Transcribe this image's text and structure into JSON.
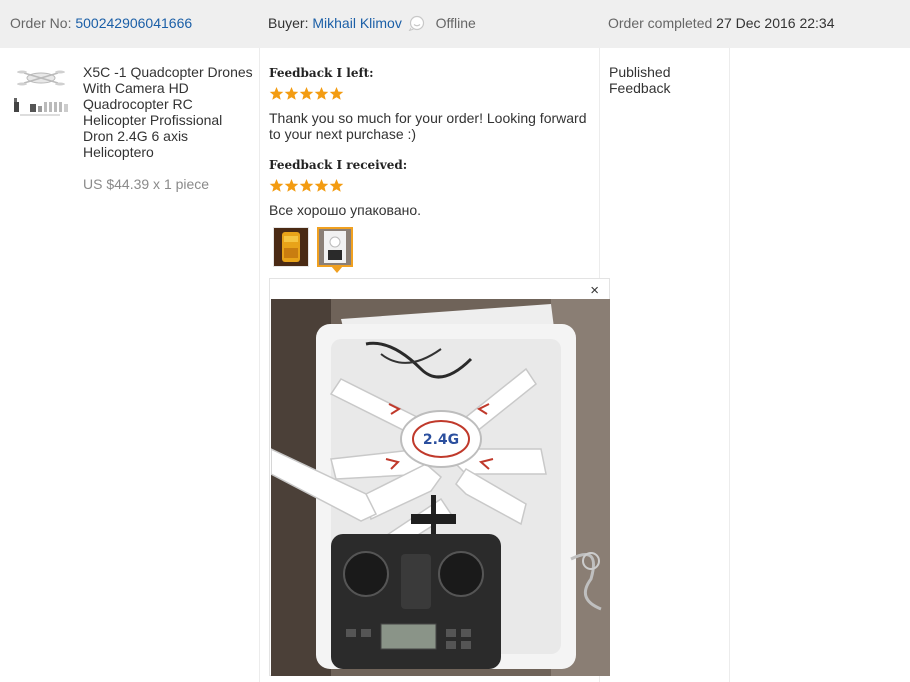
{
  "order": {
    "number_label": "Order No:",
    "number": "500242906041666",
    "buyer_label": "Buyer:",
    "buyer_name": "Mikhail Klimov",
    "buyer_status": "Offline",
    "status_label": "Order completed",
    "completed_date": "27 Dec 2016 22:34"
  },
  "product": {
    "title": "X5C -1 Quadcopter Drones With Camera HD Quadrocopter RC Helicopter Profissional Dron 2.4G 6 axis Helicoptero",
    "price_line": "US $44.39 x 1 piece"
  },
  "feedback_left": {
    "heading": "Feedback I left:",
    "stars": 5,
    "text": "Thank you so much for your order! Looking forward to your next purchase :)"
  },
  "feedback_received": {
    "heading": "Feedback I received:",
    "stars": 5,
    "text": "Все хорошо упаковано."
  },
  "status_column": {
    "line1": "Published",
    "line2": "Feedback"
  },
  "preview": {
    "close_symbol": "×",
    "photo_badge": "2.4G"
  },
  "colors": {
    "link": "#1b5fa7",
    "star": "#f39c12",
    "selected_border": "#f0a020",
    "header_bg": "#efefef"
  }
}
